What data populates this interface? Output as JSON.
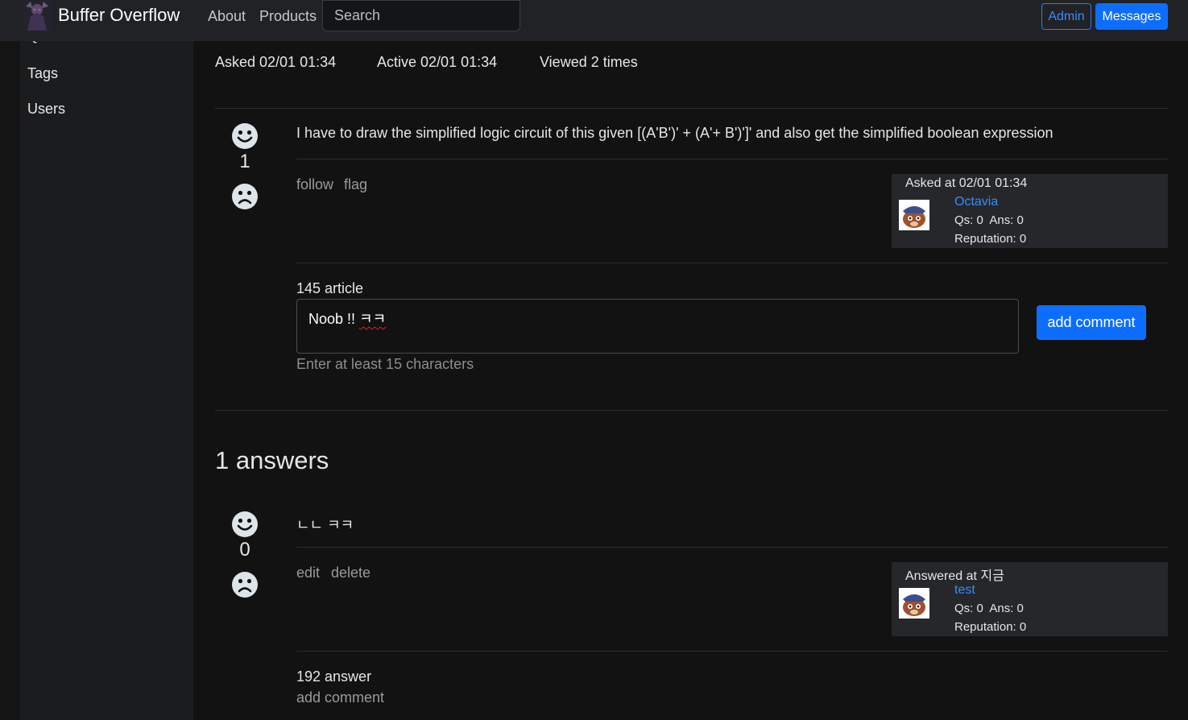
{
  "navbar": {
    "brand": "Buffer Overflow",
    "links": [
      "About",
      "Products"
    ],
    "search_placeholder": "Search",
    "admin_label": "Admin",
    "messages_label": "Messages"
  },
  "sidebar": {
    "cut_item": "Questions",
    "items": [
      "Tags",
      "Users"
    ]
  },
  "question": {
    "asked": "Asked 02/01 01:34",
    "active": "Active 02/01 01:34",
    "viewed": "Viewed 2 times",
    "votes": "1",
    "body": "I have to draw the simplified logic circuit of this given [(A'B')' + (A'+ B')']' and also get the simplified boolean expression",
    "actions": [
      "follow",
      "flag"
    ],
    "card": {
      "asked_at": "Asked at 02/01 01:34",
      "user": "Octavia",
      "stats": "Qs: 0  Ans: 0",
      "reputation": "Reputation: 0"
    },
    "comment_label": "145 article",
    "comment_value": "Noob !! ",
    "comment_value_marked": "ㅋㅋ",
    "comment_help": "Enter at least 15 characters",
    "add_comment_button": "add comment"
  },
  "answers": {
    "title": "1 answers",
    "items": [
      {
        "votes": "0",
        "body": "ㄴㄴ ㅋㅋ",
        "actions": [
          "edit",
          "delete"
        ],
        "card": {
          "answered_at": "Answered at 지금",
          "user": "test",
          "stats": "Qs: 0  Ans: 0",
          "reputation": "Reputation: 0"
        },
        "comment_label": "192 answer",
        "add_comment_link": "add comment"
      }
    ]
  },
  "colors": {
    "background": "#121212",
    "navbar": "#202225",
    "sidebar": "#1b1c1e",
    "card": "#25272b",
    "accent": "#0d6efd",
    "link": "#3d8bff"
  }
}
